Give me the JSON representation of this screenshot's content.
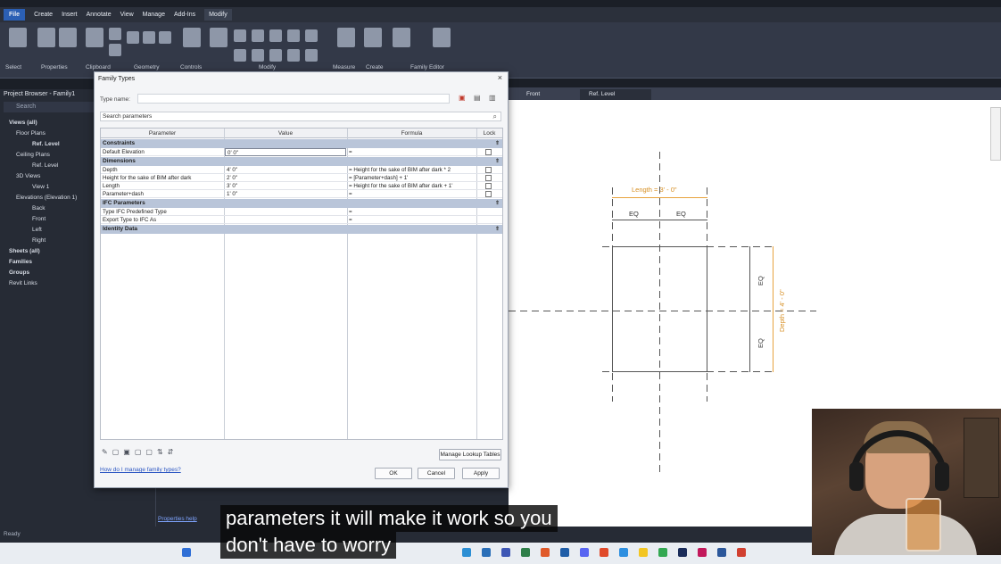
{
  "menubar": {
    "items": [
      "File",
      "Create",
      "Insert",
      "Annotate",
      "View",
      "Manage",
      "Add-Ins",
      "Modify"
    ]
  },
  "ribbon": {
    "panels": [
      "Select",
      "Properties",
      "Clipboard",
      "Geometry",
      "Controls",
      "Modify",
      "Measure",
      "Create",
      "Family Editor"
    ]
  },
  "browser": {
    "title": "Project Browser - Family1",
    "search_placeholder": "Search",
    "tree": [
      "Views (all)",
      "Floor Plans",
      "Ref. Level",
      "Ceiling Plans",
      "Ref. Level",
      "3D Views",
      "View 1",
      "Elevations (Elevation 1)",
      "Back",
      "Front",
      "Left",
      "Right",
      "Sheets (all)",
      "Families",
      "Groups",
      "Revit Links"
    ]
  },
  "properties_help": "Properties help",
  "status": "Ready",
  "view_tabs": [
    "Front",
    "Ref. Level"
  ],
  "dialog": {
    "title": "Family Types",
    "type_name_label": "Type name:",
    "search_placeholder": "Search parameters",
    "columns": [
      "Parameter",
      "Value",
      "Formula",
      "Lock"
    ],
    "groups": {
      "constraints": "Constraints",
      "dimensions": "Dimensions",
      "ifc": "IFC Parameters",
      "identity": "Identity Data"
    },
    "rows": {
      "default_elevation": {
        "param": "Default Elevation",
        "value": "0' 0\"",
        "formula": "="
      },
      "depth": {
        "param": "Depth",
        "value": "4' 0\"",
        "formula": "= Height for the sake of BIM after dark * 2"
      },
      "height": {
        "param": "Height for the sake of BIM after dark",
        "value": "2' 0\"",
        "formula": "= [Parameter+dash] + 1'"
      },
      "length": {
        "param": "Length",
        "value": "3' 0\"",
        "formula": "= Height for the sake of BIM after dark + 1'"
      },
      "paramdash": {
        "param": "Parameter+dash",
        "value": "1' 0\"",
        "formula": "="
      },
      "ifc_type": {
        "param": "Type IFC Predefined Type",
        "value": "",
        "formula": "="
      },
      "export_type": {
        "param": "Export Type to IFC As",
        "value": "",
        "formula": "="
      }
    },
    "manage_lookup": "Manage Lookup Tables",
    "help_link": "How do I manage family types?",
    "ok": "OK",
    "cancel": "Cancel",
    "apply": "Apply"
  },
  "drawing": {
    "length_label": "Length = 3' - 0\"",
    "depth_label": "Depth = 4' - 0\"",
    "eq": "EQ"
  },
  "caption": {
    "line1": "parameters it will make it work so you",
    "line2": "don't have to worry"
  },
  "colors": {
    "accent": "#2b5fb4",
    "dim_orange": "#e7a33e",
    "group_band": "#b9c5d9"
  }
}
